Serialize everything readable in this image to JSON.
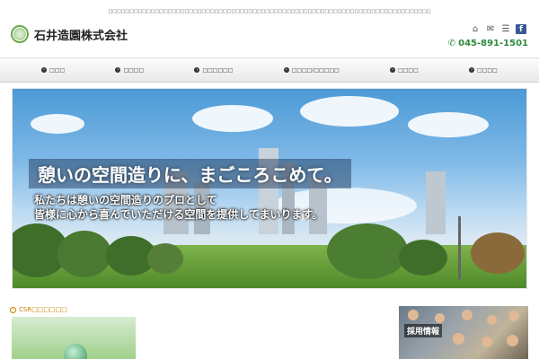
{
  "top_notice": "□□□□□□□□□□□□□□□□□□□□□□□□□□□□□□□□□□□□□□□□□□□□□□□□□□□□□□□□□□□□□□□□□□□□□□□□□□□□",
  "header": {
    "company_name": "石井造園株式会社",
    "phone": "045-891-1501",
    "icons": [
      "home-icon",
      "mail-icon",
      "list-icon",
      "facebook-icon"
    ]
  },
  "nav": {
    "items": [
      {
        "label": "□□□"
      },
      {
        "label": "□□□□"
      },
      {
        "label": "□□□□□□"
      },
      {
        "label": "□□□□/□□□□□"
      },
      {
        "label": "□□□□"
      },
      {
        "label": "□□□□"
      }
    ]
  },
  "hero": {
    "headline": "憩いの空間造りに、まごころこめて。",
    "subline1": "私たちは憩いの空間造りのプロとして",
    "subline2": "皆様に心から喜んでいただける空間を提供してまいります。"
  },
  "csr": {
    "label": "CSR□□□□□□"
  },
  "recruit": {
    "label": "採用情報"
  },
  "colors": {
    "accent_green": "#2e8b3d",
    "csr_orange": "#d07a00",
    "facebook_blue": "#3b5998"
  }
}
